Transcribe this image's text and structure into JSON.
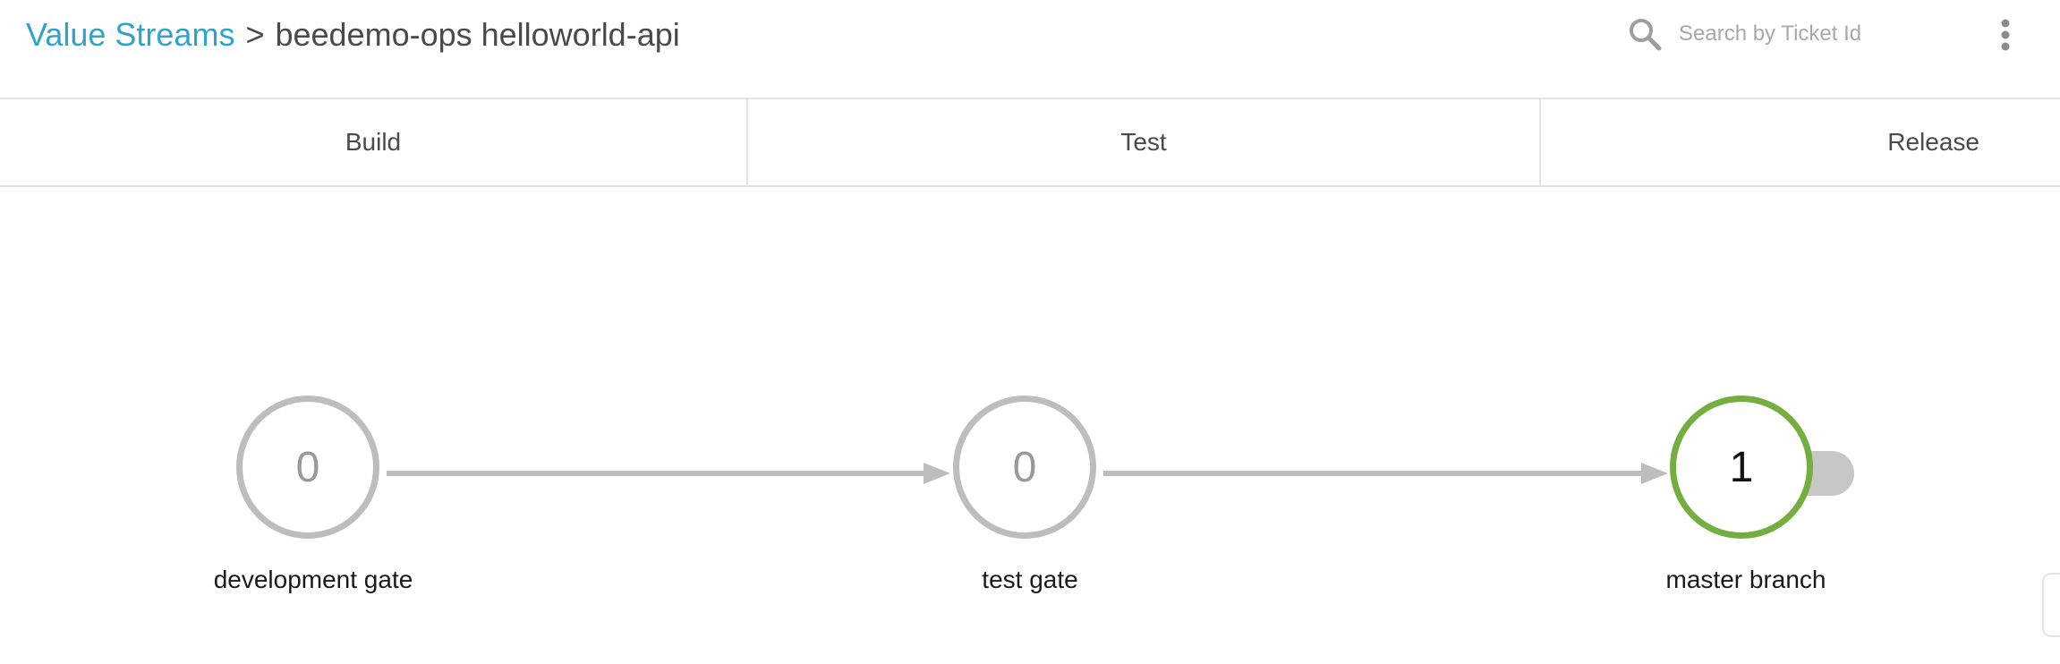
{
  "breadcrumb": {
    "root": "Value Streams",
    "separator": ">",
    "current": "beedemo-ops helloworld-api"
  },
  "search": {
    "placeholder": "Search by Ticket Id",
    "value": "",
    "icon": "search-icon"
  },
  "menu": {
    "icon": "kebab-menu-icon"
  },
  "phases": [
    {
      "label": "Build"
    },
    {
      "label": "Test"
    },
    {
      "label": "Release"
    }
  ],
  "graph": {
    "nodes": [
      {
        "count": "0",
        "label": "development gate",
        "status": "inactive"
      },
      {
        "count": "0",
        "label": "test gate",
        "status": "inactive"
      },
      {
        "count": "1",
        "label": "master branch",
        "status": "active"
      }
    ],
    "colors": {
      "inactive": "#bdbdbd",
      "active": "#74ae3f",
      "edge": "#bdbdbd",
      "link": "#2fa3c9"
    }
  }
}
